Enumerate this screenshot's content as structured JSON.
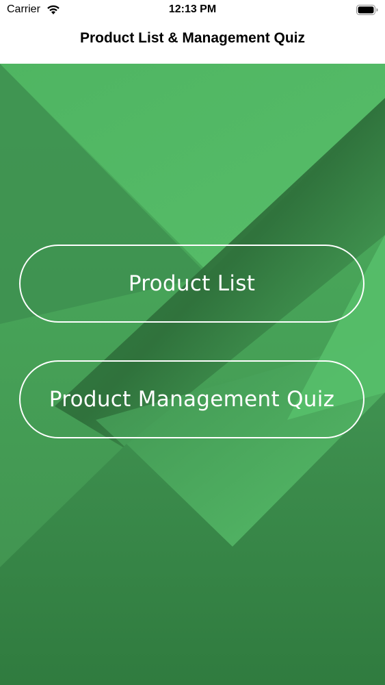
{
  "status_bar": {
    "carrier": "Carrier",
    "time": "12:13 PM",
    "icons": [
      "wifi-icon",
      "battery-icon"
    ]
  },
  "nav": {
    "title": "Product List & Management Quiz"
  },
  "main": {
    "buttons": [
      {
        "label": "Product List"
      },
      {
        "label": "Product Management Quiz"
      }
    ]
  },
  "colors": {
    "background_base": "#4aa85c",
    "background_light": "#5cc46e",
    "background_dark": "#2f7a3e",
    "button_border": "#ffffff",
    "button_text": "#ffffff"
  }
}
